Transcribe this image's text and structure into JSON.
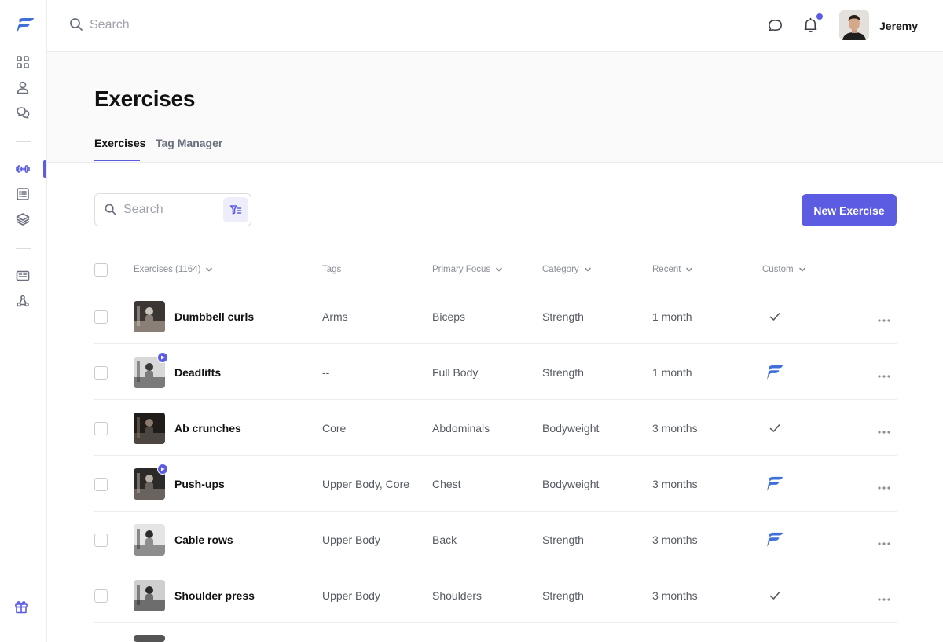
{
  "topbar": {
    "search_placeholder": "Search",
    "user_name": "Jeremy",
    "notification_dot": true
  },
  "sidebar": {
    "items": [
      {
        "icon": "dashboard-grid-icon"
      },
      {
        "icon": "user-icon"
      },
      {
        "icon": "chat-bubbles-icon"
      },
      {
        "icon": "dumbbell-icon",
        "active": true
      },
      {
        "icon": "list-icon"
      },
      {
        "icon": "layers-icon"
      },
      {
        "icon": "id-card-icon"
      },
      {
        "icon": "webhook-icon"
      },
      {
        "icon": "gift-icon"
      }
    ]
  },
  "page": {
    "title": "Exercises",
    "tabs": [
      {
        "label": "Exercises",
        "active": true
      },
      {
        "label": "Tag Manager",
        "active": false
      }
    ]
  },
  "toolbar": {
    "search_placeholder": "Search",
    "new_button_label": "New Exercise"
  },
  "table": {
    "columns": {
      "exercises": "Exercises (1164)",
      "tags": "Tags",
      "primary_focus": "Primary Focus",
      "category": "Category",
      "recent": "Recent",
      "custom": "Custom"
    },
    "rows": [
      {
        "name": "Dumbbell curls",
        "tags": "Arms",
        "primary_focus": "Biceps",
        "category": "Strength",
        "recent": "1 month",
        "custom": "check",
        "video": false
      },
      {
        "name": "Deadlifts",
        "tags": "--",
        "primary_focus": "Full Body",
        "category": "Strength",
        "recent": "1 month",
        "custom": "brand",
        "video": true
      },
      {
        "name": "Ab crunches",
        "tags": "Core",
        "primary_focus": "Abdominals",
        "category": "Bodyweight",
        "recent": "3 months",
        "custom": "check",
        "video": false
      },
      {
        "name": "Push-ups",
        "tags": "Upper Body, Core",
        "primary_focus": "Chest",
        "category": "Bodyweight",
        "recent": "3 months",
        "custom": "brand",
        "video": true
      },
      {
        "name": "Cable rows",
        "tags": "Upper Body",
        "primary_focus": "Back",
        "category": "Strength",
        "recent": "3 months",
        "custom": "brand",
        "video": false
      },
      {
        "name": "Shoulder press",
        "tags": "Upper Body",
        "primary_focus": "Shoulders",
        "category": "Strength",
        "recent": "3 months",
        "custom": "check",
        "video": false
      }
    ]
  },
  "colors": {
    "accent": "#5b5ce2",
    "brand_logo": "#3f6fd8"
  }
}
